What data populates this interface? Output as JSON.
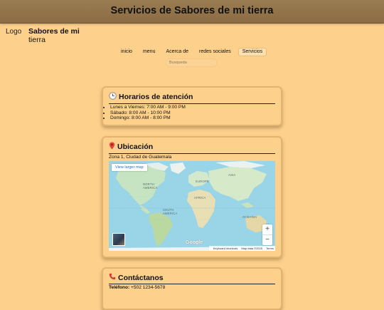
{
  "header": {
    "title": "Servicios de Sabores de mi tierra"
  },
  "brand": {
    "logo_alt": "Logo",
    "name_line1": "Sabores de mi",
    "name_line2": "tierra"
  },
  "nav": {
    "items": [
      "inicio",
      "menu",
      "Acerca de",
      "redes sociales",
      "Servicios"
    ],
    "active": "Servicios"
  },
  "search": {
    "placeholder": "Busqueda"
  },
  "hours": {
    "icon": "clock-icon",
    "title": "Horarios de atención",
    "items": [
      "Lunes a Viernes: 7:00 AM - 9:00 PM",
      "Sábado: 8:00 AM - 10:00 PM",
      "Domingo: 8:00 AM - 8:00 PM"
    ]
  },
  "location": {
    "icon": "pin-icon",
    "title": "Ubicación",
    "address": "Zona 1, Ciudad de Guatemala",
    "map": {
      "larger_link": "View larger map",
      "zoom_in": "+",
      "zoom_out": "−",
      "google": "Google",
      "shortcuts": "Keyboard shortcuts",
      "map_data": "Map data ©2025",
      "terms": "Terms",
      "labels": {
        "europe": "EUROPE",
        "asia": "ASIA",
        "north_america": "NORTH AMERICA",
        "africa": "AFRICA",
        "south_america": "SOUTH AMERICA",
        "oceania": "OCEANIA"
      }
    }
  },
  "contact": {
    "icon": "phone-icon",
    "title": "Contáctanos",
    "phone_label": "Teléfono:",
    "phone": "+502 1234-5678"
  },
  "colors": {
    "background": "#fdd08c",
    "topbar": "#8f7048",
    "card_border": "#e2b46f"
  }
}
